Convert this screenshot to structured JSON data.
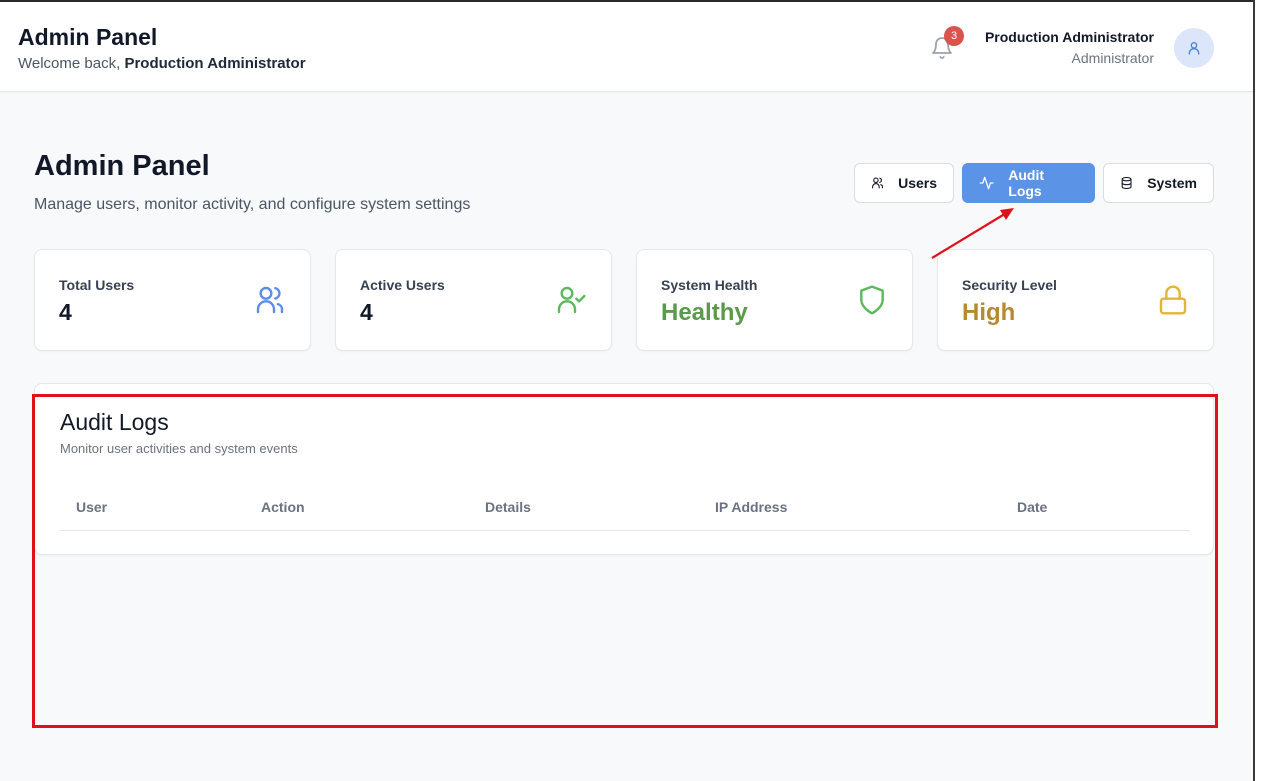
{
  "header": {
    "title": "Admin Panel",
    "welcome_prefix": "Welcome back, ",
    "welcome_name": "Production Administrator",
    "notification_count": "3",
    "user_name": "Production Administrator",
    "user_role": "Administrator"
  },
  "page": {
    "title": "Admin Panel",
    "subtitle": "Manage users, monitor activity, and configure system settings"
  },
  "tabs": [
    {
      "label": "Users",
      "icon": "users-icon",
      "active": false
    },
    {
      "label": "Audit Logs",
      "icon": "activity-icon",
      "active": true
    },
    {
      "label": "System",
      "icon": "database-icon",
      "active": false
    }
  ],
  "stats": [
    {
      "label": "Total Users",
      "value": "4",
      "icon": "users-icon",
      "color": "#5b8def"
    },
    {
      "label": "Active Users",
      "value": "4",
      "icon": "user-check-icon",
      "color": "#5cb85c"
    },
    {
      "label": "System Health",
      "value": "Healthy",
      "icon": "shield-icon",
      "color": "#5cb85c"
    },
    {
      "label": "Security Level",
      "value": "High",
      "icon": "lock-icon",
      "color": "#e3b43a"
    }
  ],
  "audit": {
    "title": "Audit Logs",
    "subtitle": "Monitor user activities and system events",
    "columns": [
      "User",
      "Action",
      "Details",
      "IP Address",
      "Date"
    ],
    "rows": []
  },
  "colors": {
    "primary": "#5b93e6",
    "annotation": "#e0111b",
    "badge": "#d9534f"
  }
}
